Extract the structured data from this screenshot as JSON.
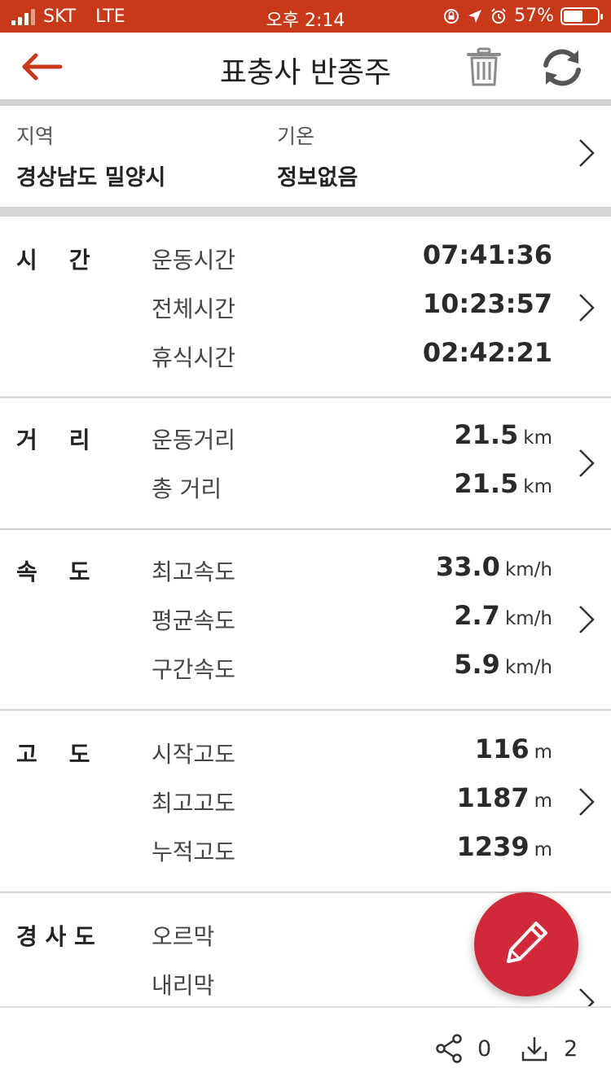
{
  "status_bar": {
    "carrier": "SKT",
    "network": "LTE",
    "time": "오후 2:14",
    "battery": "57%",
    "battery_level": 0.57
  },
  "header": {
    "title": "표충사 반종주",
    "back_icon": "arrow-left-icon",
    "trash_icon": "trash-icon",
    "refresh_icon": "refresh-icon",
    "accent_color": "#c8391a"
  },
  "region": {
    "region_label": "지역",
    "region_value": "경상남도 밀양시",
    "temp_label": "기온",
    "temp_value": "정보없음"
  },
  "sections": {
    "time": {
      "category": "시    간",
      "rows": [
        {
          "label": "운동시간",
          "value": "07:41:36",
          "unit": ""
        },
        {
          "label": "전체시간",
          "value": "10:23:57",
          "unit": ""
        },
        {
          "label": "휴식시간",
          "value": "02:42:21",
          "unit": ""
        }
      ]
    },
    "distance": {
      "category": "거    리",
      "rows": [
        {
          "label": "운동거리",
          "value": "21.5",
          "unit": "km"
        },
        {
          "label": "총 거리",
          "value": "21.5",
          "unit": "km"
        }
      ]
    },
    "speed": {
      "category": "속    도",
      "rows": [
        {
          "label": "최고속도",
          "value": "33.0",
          "unit": "km/h"
        },
        {
          "label": "평균속도",
          "value": "2.7",
          "unit": "km/h"
        },
        {
          "label": "구간속도",
          "value": "5.9",
          "unit": "km/h"
        }
      ]
    },
    "altitude": {
      "category": "고    도",
      "rows": [
        {
          "label": "시작고도",
          "value": "116",
          "unit": "m"
        },
        {
          "label": "최고고도",
          "value": "1187",
          "unit": "m"
        },
        {
          "label": "누적고도",
          "value": "1239",
          "unit": "m"
        }
      ]
    },
    "slope": {
      "category": "경 사 도",
      "rows": [
        {
          "label": "오르막",
          "value": "",
          "unit": ""
        },
        {
          "label": "내리막",
          "value": "",
          "unit": ""
        }
      ]
    }
  },
  "fab": {
    "icon": "pencil-icon",
    "color": "#d0293a"
  },
  "bottom_bar": {
    "share_icon": "share-icon",
    "share_count": "0",
    "download_icon": "download-icon",
    "download_count": "2"
  }
}
